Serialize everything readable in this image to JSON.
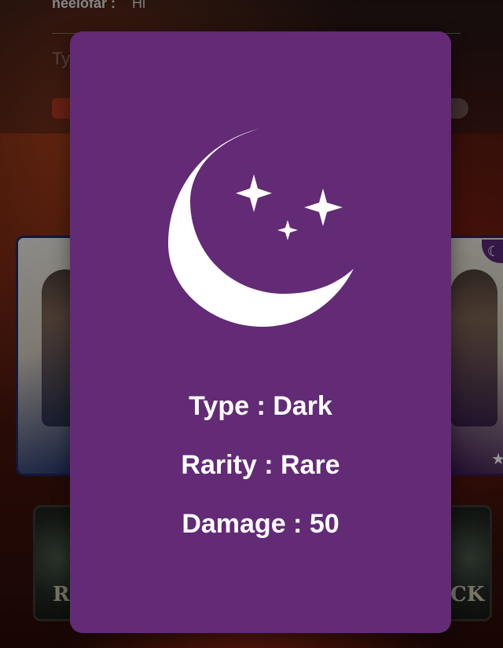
{
  "chat": {
    "username": "neelofar :",
    "message": "Hi",
    "input_placeholder": "Ty"
  },
  "background_cards": {
    "left_button_text": "R",
    "right_button_text": "CK"
  },
  "modal": {
    "icon": "crescent-moon-stars-icon",
    "background_color": "#632a76",
    "type_text": "Type : Dark",
    "rarity_text": "Rarity : Rare",
    "damage_text": "Damage : 50"
  }
}
